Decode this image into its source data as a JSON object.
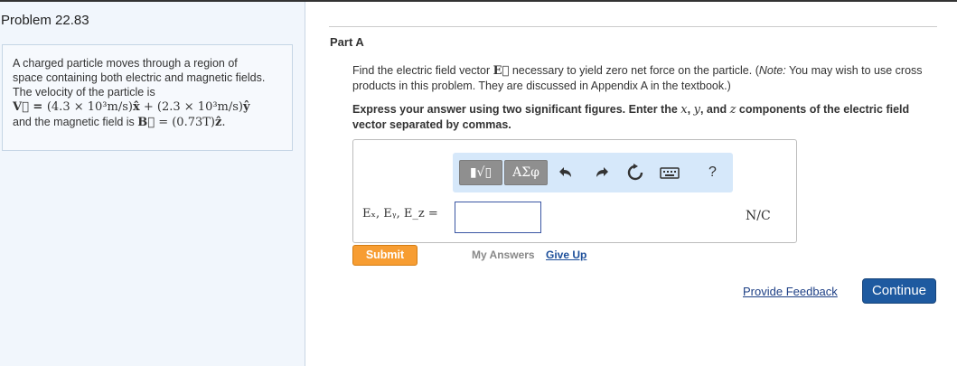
{
  "problem": {
    "title": "Problem 22.83",
    "text_line1": "A charged particle moves through a region of",
    "text_line2": "space containing both electric and magnetic fields.",
    "text_line3": "The velocity of the particle is",
    "velocity_lhs": "V⃗ = ",
    "velocity_term1": "(4.3 × 10³m/s)",
    "velocity_unit1": "x̂",
    "velocity_plus": " + ",
    "velocity_term2": "(2.3 × 10³m/s)",
    "velocity_unit2": "ŷ",
    "field_prefix": "and the magnetic field is ",
    "field_symbol": "B⃗",
    "field_eq": " = (0.73T)",
    "field_unit": "ẑ",
    "field_end": "."
  },
  "part": {
    "title": "Part A",
    "question_before": "Find the electric field vector ",
    "question_symbol": "E⃗",
    "question_after": " necessary to yield zero net force on the particle. (",
    "question_note": "Note:",
    "question_tail": " You may wish to use cross products in this problem. They are discussed in Appendix A in the textbook.)",
    "instruction_before": "Express your answer using two significant figures. Enter the ",
    "instruction_x": "x",
    "instruction_sep1": ", ",
    "instruction_y": "y",
    "instruction_sep2": ", and ",
    "instruction_z": "z",
    "instruction_after": " components of the electric field vector separated by commas."
  },
  "toolbar": {
    "templates_label": "▮√▯",
    "symbols_label": "ΑΣφ",
    "undo_icon": "undo-icon",
    "redo_icon": "redo-icon",
    "reset_icon": "reset-icon",
    "keyboard_icon": "keyboard-icon",
    "help_label": "?"
  },
  "answer": {
    "label": "Eₓ, Eᵧ, E_z =",
    "value": "",
    "unit": "N/C"
  },
  "actions": {
    "submit": "Submit",
    "my_answers": "My Answers",
    "give_up": "Give Up",
    "provide_feedback": "Provide Feedback",
    "continue": "Continue"
  },
  "colors": {
    "submit": "#f79d32",
    "continue": "#1e5aa0",
    "toolbar": "#d6e8fa",
    "left_panel": "#f1f6fc"
  }
}
